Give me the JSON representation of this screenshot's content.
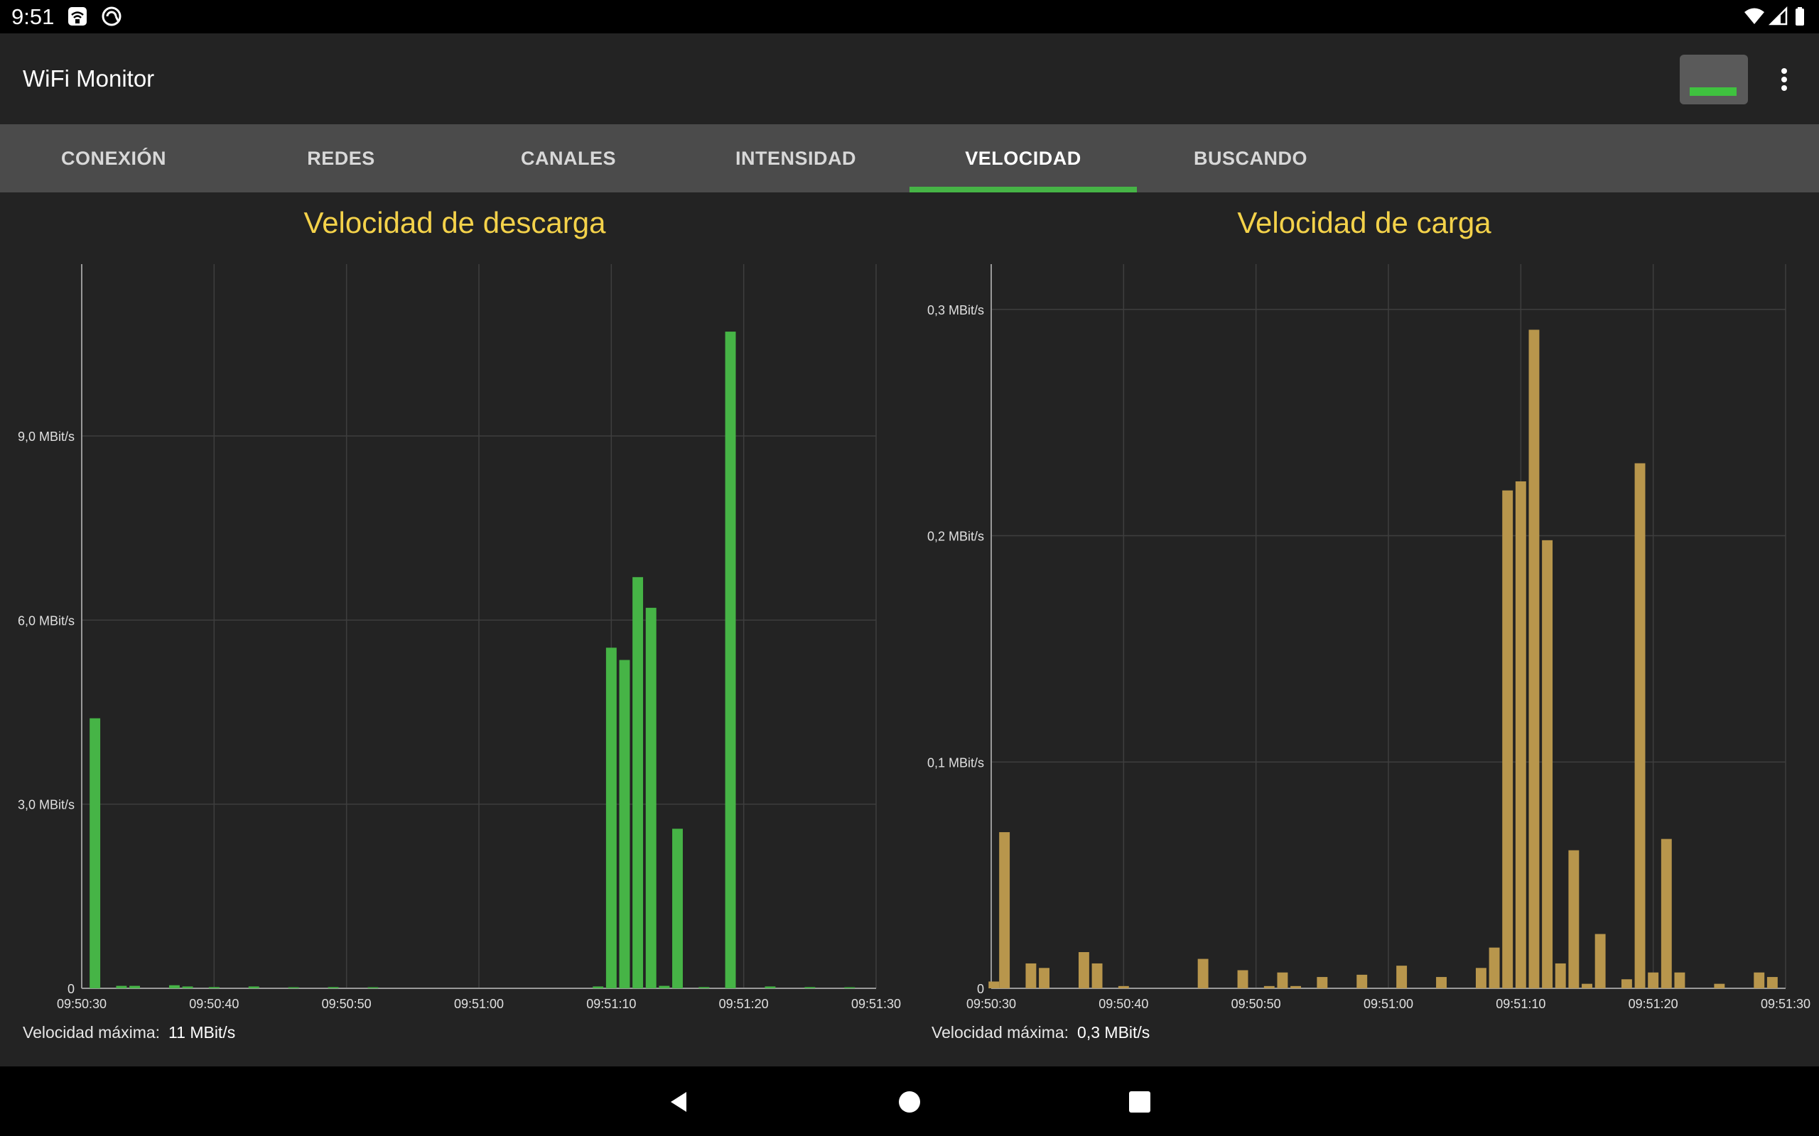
{
  "status_bar": {
    "time": "9:51",
    "icons": [
      "wifi-calling-icon",
      "sync-icon",
      "wifi-signal-icon",
      "cell-signal-icon",
      "battery-icon"
    ]
  },
  "app": {
    "title": "WiFi Monitor",
    "actions": [
      "battery-level-button",
      "overflow-menu-icon"
    ]
  },
  "tabs": [
    {
      "label": "CONEXIÓN",
      "active": false
    },
    {
      "label": "REDES",
      "active": false
    },
    {
      "label": "CANALES",
      "active": false
    },
    {
      "label": "INTENSIDAD",
      "active": false
    },
    {
      "label": "VELOCIDAD",
      "active": true
    },
    {
      "label": "BUSCANDO",
      "active": false
    }
  ],
  "colors": {
    "accent": "#46b446",
    "title": "#f4d24a",
    "download_bar": "#46b446",
    "upload_bar": "#b8964c",
    "background": "#232323"
  },
  "download": {
    "title": "Velocidad de descarga",
    "max_label": "Velocidad máxima:",
    "max_value": "11 MBit/s"
  },
  "upload": {
    "title": "Velocidad de carga",
    "max_label": "Velocidad máxima:",
    "max_value": "0,3 MBit/s"
  },
  "chart_data": [
    {
      "type": "bar",
      "title": "Velocidad de descarga",
      "unit": "MBit/s",
      "ylim": [
        0,
        11.8
      ],
      "yticks": [
        {
          "value": 0,
          "label": "0"
        },
        {
          "value": 3,
          "label": "3,0 MBit/s"
        },
        {
          "value": 6,
          "label": "6,0 MBit/s"
        },
        {
          "value": 9,
          "label": "9,0 MBit/s"
        }
      ],
      "xlim": [
        0,
        60
      ],
      "xticks": [
        {
          "value": 0,
          "label": "09:50:30"
        },
        {
          "value": 10,
          "label": "09:50:40"
        },
        {
          "value": 20,
          "label": "09:50:50"
        },
        {
          "value": 30,
          "label": "09:51:00"
        },
        {
          "value": 40,
          "label": "09:51:10"
        },
        {
          "value": 50,
          "label": "09:51:20"
        },
        {
          "value": 60,
          "label": "09:51:30"
        }
      ],
      "grid": true,
      "points": [
        {
          "x": 1,
          "y": 4.4
        },
        {
          "x": 3,
          "y": 0.04
        },
        {
          "x": 4,
          "y": 0.04
        },
        {
          "x": 7,
          "y": 0.05
        },
        {
          "x": 8,
          "y": 0.03
        },
        {
          "x": 10,
          "y": 0.02
        },
        {
          "x": 13,
          "y": 0.03
        },
        {
          "x": 16,
          "y": 0.01
        },
        {
          "x": 19,
          "y": 0.02
        },
        {
          "x": 22,
          "y": 0.01
        },
        {
          "x": 39,
          "y": 0.03
        },
        {
          "x": 40,
          "y": 5.55
        },
        {
          "x": 41,
          "y": 5.35
        },
        {
          "x": 42,
          "y": 6.7
        },
        {
          "x": 43,
          "y": 6.2
        },
        {
          "x": 44,
          "y": 0.04
        },
        {
          "x": 45,
          "y": 2.6
        },
        {
          "x": 47,
          "y": 0.02
        },
        {
          "x": 49,
          "y": 10.7
        },
        {
          "x": 52,
          "y": 0.03
        },
        {
          "x": 55,
          "y": 0.02
        },
        {
          "x": 58,
          "y": 0.01
        }
      ]
    },
    {
      "type": "bar",
      "title": "Velocidad de carga",
      "unit": "MBit/s",
      "ylim": [
        0,
        0.32
      ],
      "yticks": [
        {
          "value": 0,
          "label": "0"
        },
        {
          "value": 0.1,
          "label": "0,1 MBit/s"
        },
        {
          "value": 0.2,
          "label": "0,2 MBit/s"
        },
        {
          "value": 0.3,
          "label": "0,3 MBit/s"
        }
      ],
      "xlim": [
        0,
        60
      ],
      "xticks": [
        {
          "value": 0,
          "label": "09:50:30"
        },
        {
          "value": 10,
          "label": "09:50:40"
        },
        {
          "value": 20,
          "label": "09:50:50"
        },
        {
          "value": 30,
          "label": "09:51:00"
        },
        {
          "value": 40,
          "label": "09:51:10"
        },
        {
          "value": 50,
          "label": "09:51:20"
        },
        {
          "value": 60,
          "label": "09:51:30"
        }
      ],
      "grid": true,
      "points": [
        {
          "x": 0.2,
          "y": 0.003
        },
        {
          "x": 1,
          "y": 0.069
        },
        {
          "x": 3,
          "y": 0.011
        },
        {
          "x": 4,
          "y": 0.009
        },
        {
          "x": 7,
          "y": 0.016
        },
        {
          "x": 8,
          "y": 0.011
        },
        {
          "x": 10,
          "y": 0.001
        },
        {
          "x": 16,
          "y": 0.013
        },
        {
          "x": 19,
          "y": 0.008
        },
        {
          "x": 21,
          "y": 0.001
        },
        {
          "x": 22,
          "y": 0.007
        },
        {
          "x": 23,
          "y": 0.001
        },
        {
          "x": 25,
          "y": 0.005
        },
        {
          "x": 28,
          "y": 0.006
        },
        {
          "x": 31,
          "y": 0.01
        },
        {
          "x": 34,
          "y": 0.005
        },
        {
          "x": 37,
          "y": 0.009
        },
        {
          "x": 38,
          "y": 0.018
        },
        {
          "x": 39,
          "y": 0.22
        },
        {
          "x": 40,
          "y": 0.224
        },
        {
          "x": 41,
          "y": 0.291
        },
        {
          "x": 42,
          "y": 0.198
        },
        {
          "x": 43,
          "y": 0.011
        },
        {
          "x": 44,
          "y": 0.061
        },
        {
          "x": 45,
          "y": 0.002
        },
        {
          "x": 46,
          "y": 0.024
        },
        {
          "x": 48,
          "y": 0.004
        },
        {
          "x": 49,
          "y": 0.232
        },
        {
          "x": 50,
          "y": 0.007
        },
        {
          "x": 51,
          "y": 0.066
        },
        {
          "x": 52,
          "y": 0.007
        },
        {
          "x": 55,
          "y": 0.002
        },
        {
          "x": 58,
          "y": 0.007
        },
        {
          "x": 59,
          "y": 0.005
        }
      ]
    }
  ]
}
